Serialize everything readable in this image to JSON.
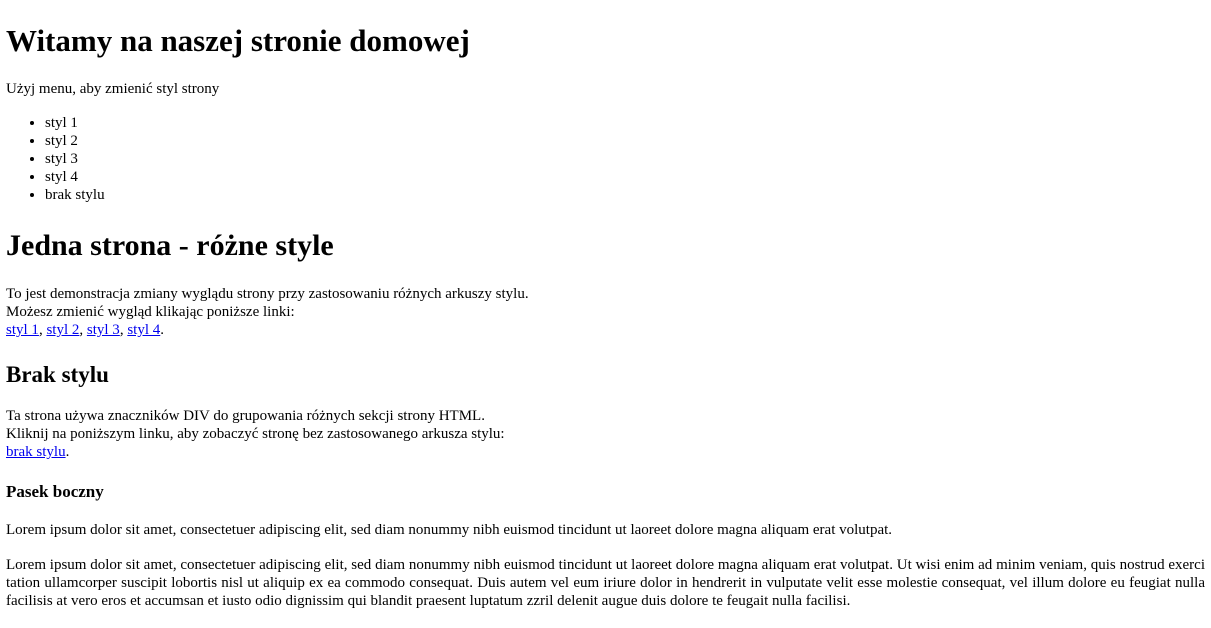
{
  "header": {
    "title": "Witamy na naszej stronie domowej",
    "subtitle": "Użyj menu, aby zmienić styl strony"
  },
  "menu": {
    "items": [
      {
        "label": "styl 1"
      },
      {
        "label": "styl 2"
      },
      {
        "label": "styl 3"
      },
      {
        "label": "styl 4"
      },
      {
        "label": "brak stylu"
      }
    ]
  },
  "section_main": {
    "heading": "Jedna strona - różne style",
    "line1": "To jest demonstracja zmiany wyglądu strony przy zastosowaniu różnych arkuszy stylu.",
    "line2": "Możesz zmienić wygląd klikając poniższe linki:",
    "links": [
      {
        "label": "styl 1"
      },
      {
        "label": "styl 2"
      },
      {
        "label": "styl 3"
      },
      {
        "label": "styl 4"
      }
    ],
    "sep": ", ",
    "end": "."
  },
  "section_nostyle": {
    "heading": "Brak stylu",
    "line1": "Ta strona używa znaczników DIV do grupowania różnych sekcji strony HTML.",
    "line2": "Kliknij na poniższym linku, aby zobaczyć stronę bez zastosowanego arkusza stylu:",
    "link": "brak stylu",
    "end": "."
  },
  "sidebar": {
    "heading": "Pasek boczny",
    "para1": "Lorem ipsum dolor sit amet, consectetuer adipiscing elit, sed diam nonummy nibh euismod tincidunt ut laoreet dolore magna aliquam erat volutpat.",
    "para2": "Lorem ipsum dolor sit amet, consectetuer adipiscing elit, sed diam nonummy nibh euismod tincidunt ut laoreet dolore magna aliquam erat volutpat. Ut wisi enim ad minim veniam, quis nostrud exerci tation ullamcorper suscipit lobortis nisl ut aliquip ex ea commodo consequat. Duis autem vel eum iriure dolor in hendrerit in vulputate velit esse molestie consequat, vel illum dolore eu feugiat nulla facilisis at vero eros et accumsan et iusto odio dignissim qui blandit praesent luptatum zzril delenit augue duis dolore te feugait nulla facilisi."
  },
  "colors": {
    "link": "#0000ee",
    "text": "#000000",
    "background": "#ffffff"
  }
}
